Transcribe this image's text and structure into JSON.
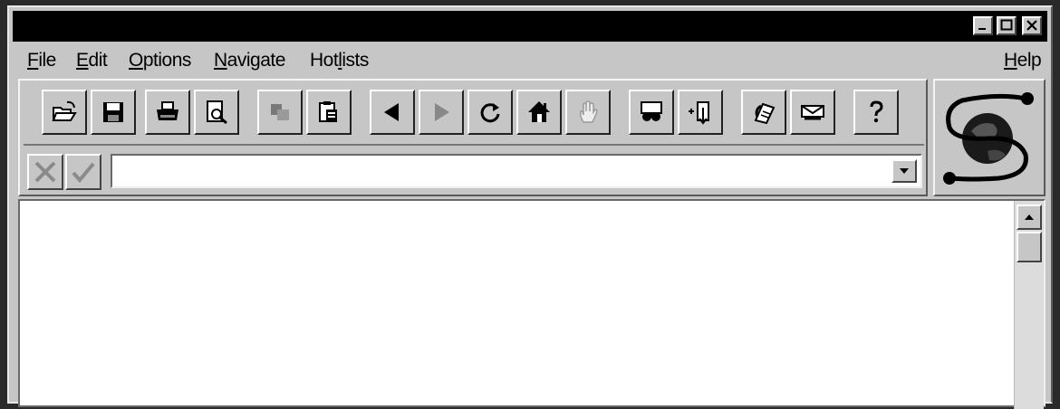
{
  "window": {
    "title": "",
    "controls": {
      "minimize": "_",
      "maximize": "□",
      "close": "✕"
    }
  },
  "menubar": {
    "items": [
      {
        "label": "File",
        "hotkey_index": 0
      },
      {
        "label": "Edit",
        "hotkey_index": 0
      },
      {
        "label": "Options",
        "hotkey_index": 0
      },
      {
        "label": "Navigate",
        "hotkey_index": 0
      },
      {
        "label": "Hotlists",
        "hotkey_index": 3
      }
    ],
    "help": {
      "label": "Help",
      "hotkey_index": 0
    }
  },
  "toolbar": {
    "buttons": [
      {
        "icon": "open-folder-icon"
      },
      {
        "icon": "save-disk-icon"
      },
      {
        "icon": "print-icon"
      },
      {
        "icon": "print-preview-icon"
      },
      {
        "icon": "copy-icon",
        "disabled": true
      },
      {
        "icon": "paste-icon"
      },
      {
        "icon": "back-arrow-icon"
      },
      {
        "icon": "forward-arrow-icon",
        "disabled": true
      },
      {
        "icon": "reload-icon"
      },
      {
        "icon": "home-icon"
      },
      {
        "icon": "stop-hand-icon",
        "disabled": true
      },
      {
        "icon": "find-binoculars-icon"
      },
      {
        "icon": "add-hotlist-icon"
      },
      {
        "icon": "phone-book-icon"
      },
      {
        "icon": "mail-icon"
      },
      {
        "icon": "help-question-icon"
      }
    ]
  },
  "address": {
    "value": "",
    "placeholder": ""
  },
  "colors": {
    "chrome": "#c6c6c6",
    "titlebar": "#000000",
    "content": "#ffffff"
  }
}
